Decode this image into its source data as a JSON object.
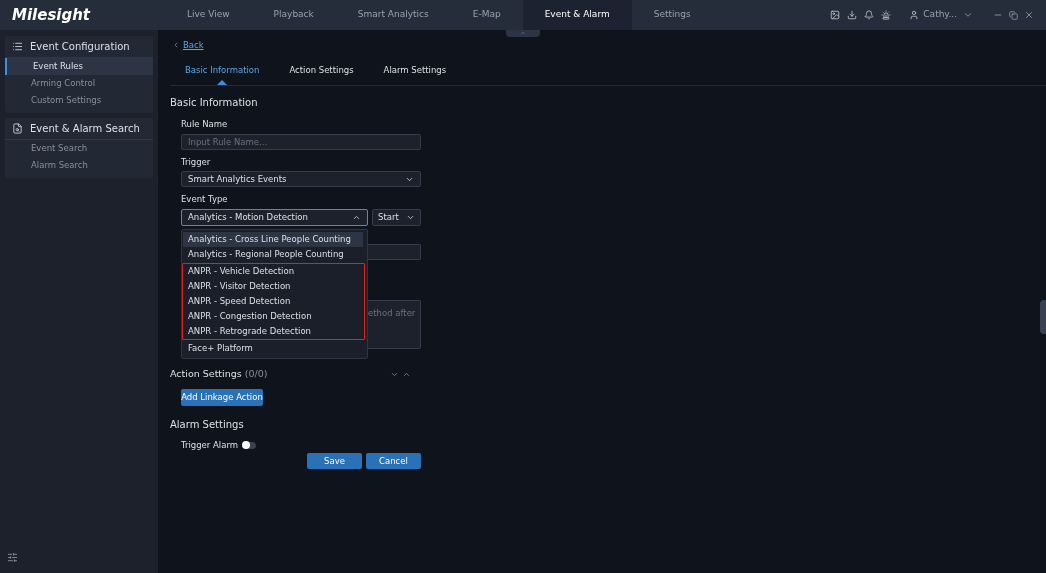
{
  "app": {
    "logo": "Milesight"
  },
  "nav_tabs": [
    {
      "label": "Live View",
      "selected": false
    },
    {
      "label": "Playback",
      "selected": false
    },
    {
      "label": "Smart Analytics",
      "selected": false
    },
    {
      "label": "E-Map",
      "selected": false
    },
    {
      "label": "Event & Alarm",
      "selected": true
    },
    {
      "label": "Settings",
      "selected": false
    }
  ],
  "user": {
    "name": "Cathy..."
  },
  "sidebar": {
    "sections": [
      {
        "title": "Event Configuration",
        "items": [
          {
            "label": "Event Rules",
            "selected": true
          },
          {
            "label": "Arming Control",
            "selected": false
          },
          {
            "label": "Custom Settings",
            "selected": false
          }
        ]
      },
      {
        "title": "Event & Alarm Search",
        "items": [
          {
            "label": "Event Search",
            "selected": false
          },
          {
            "label": "Alarm Search",
            "selected": false
          }
        ]
      }
    ]
  },
  "back_link": "Back",
  "sub_tabs": [
    {
      "label": "Basic Information",
      "selected": true
    },
    {
      "label": "Action Settings",
      "selected": false
    },
    {
      "label": "Alarm Settings",
      "selected": false
    }
  ],
  "basic": {
    "heading": "Basic Information",
    "rule_name_label": "Rule Name",
    "rule_name_placeholder": "Input Rule Name...",
    "trigger_label": "Trigger",
    "trigger_value": "Smart Analytics Events",
    "event_type_label": "Event Type",
    "event_type_value": "Analytics - Motion Detection",
    "edge_value": "Start",
    "description_visible": "ethod after"
  },
  "dropdown": {
    "groups": [
      {
        "outlined": false,
        "options": [
          {
            "label": "Analytics - Cross Line People Counting",
            "hovered": true
          },
          {
            "label": "Analytics - Regional People Counting",
            "hovered": false
          }
        ]
      },
      {
        "outlined": true,
        "options": [
          {
            "label": "ANPR - Vehicle Detection",
            "hovered": false
          },
          {
            "label": "ANPR - Visitor Detection",
            "hovered": false
          },
          {
            "label": "ANPR - Speed Detection",
            "hovered": false
          },
          {
            "label": "ANPR - Congestion Detection",
            "hovered": false
          },
          {
            "label": "ANPR - Retrograde Detection",
            "hovered": false
          }
        ]
      },
      {
        "outlined": false,
        "options": [
          {
            "label": "Face+ Platform",
            "hovered": false
          }
        ]
      }
    ]
  },
  "action": {
    "heading": "Action Settings",
    "count": "(0/0)",
    "button": "Add Linkage Action"
  },
  "alarm": {
    "heading": "Alarm Settings",
    "trigger_label": "Trigger Alarm",
    "on": false
  },
  "buttons": [
    "Save",
    "Cancel"
  ]
}
